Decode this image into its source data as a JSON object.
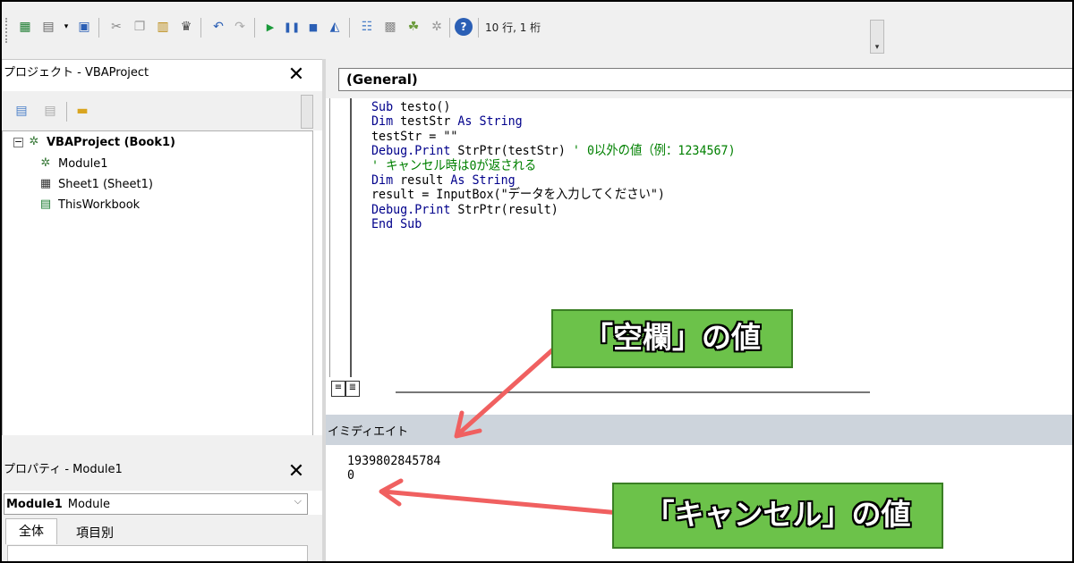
{
  "toolbar": {
    "cursor_position": "10 行, 1 桁"
  },
  "project_pane": {
    "title": "プロジェクト - VBAProject",
    "close": "✕",
    "tree": [
      {
        "label": "VBAProject (Book1)"
      },
      {
        "label": "Module1"
      },
      {
        "label": "Sheet1 (Sheet1)"
      },
      {
        "label": "ThisWorkbook"
      }
    ]
  },
  "properties_pane": {
    "title": "プロパティ - Module1",
    "close": "✕",
    "object_name": "Module1",
    "object_type": "Module",
    "tabs": [
      "全体",
      "項目別"
    ]
  },
  "code_window": {
    "object_combo": "(General)",
    "lines": [
      "Sub testo()",
      "Dim testStr As String",
      "testStr = \"\"",
      "Debug.Print StrPtr(testStr) ' 0以外の値（例：1234567)",
      "' キャンセル時は0が返される",
      "Dim result As String",
      "result = InputBox(\"データを入力してください\")",
      "Debug.Print StrPtr(result)",
      "End Sub"
    ]
  },
  "immediate_window": {
    "title": "イミディエイト",
    "lines": [
      "1939802845784",
      "0"
    ]
  },
  "callouts": {
    "blank_value": "「空欄」の値",
    "cancel_value": "「キャンセル」の値"
  },
  "colors": {
    "callout_bg": "#6cc24a",
    "arrow": "#f06060",
    "keyword": "#00008b",
    "comment": "#008000"
  }
}
